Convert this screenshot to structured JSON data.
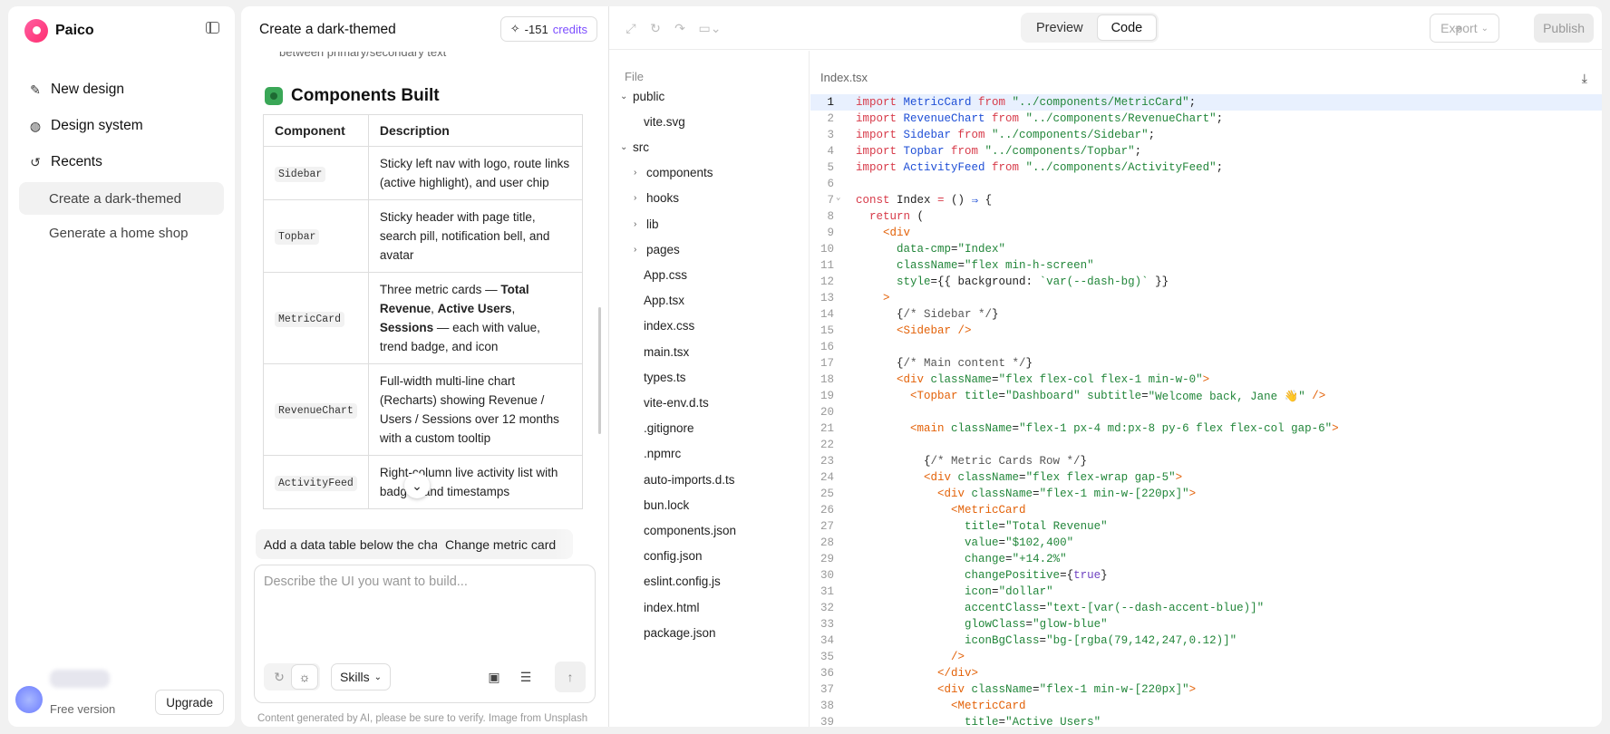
{
  "app": {
    "name": "Paico"
  },
  "sidebar": {
    "nav": [
      {
        "label": "New design",
        "icon": "edit-icon"
      },
      {
        "label": "Design system",
        "icon": "palette-icon"
      },
      {
        "label": "Recents",
        "icon": "history-icon"
      }
    ],
    "recents": [
      {
        "label": "Create a dark-themed",
        "active": true
      },
      {
        "label": "Generate a home shop",
        "active": false
      }
    ],
    "plan": "Free version",
    "upgrade": "Upgrade"
  },
  "chat": {
    "title": "Create a dark-themed",
    "credits_prefix": "-151",
    "credits_label": "credits",
    "cut_text": "between primary/secondary text",
    "section": "Components Built",
    "table": {
      "headers": [
        "Component",
        "Description"
      ],
      "rows": [
        {
          "component": "Sidebar",
          "description": "Sticky left nav with logo, route links (active highlight), and user chip"
        },
        {
          "component": "Topbar",
          "description": "Sticky header with page title, search pill, notification bell, and avatar"
        },
        {
          "component": "MetricCard",
          "description_parts": [
            "Three metric cards — ",
            "Total Revenue",
            ", ",
            "Active Users",
            ", ",
            "Sessions",
            " — each with value, trend badge, and icon"
          ]
        },
        {
          "component": "RevenueChart",
          "description": "Full-width multi-line chart (Recharts) showing Revenue / Users / Sessions over 12 months with a custom tooltip"
        },
        {
          "component": "ActivityFeed",
          "description": "Right-column live activity list with badges and timestamps"
        }
      ]
    },
    "suggestions": [
      "Add a data table below the chart",
      "Change metric card"
    ],
    "prompt_placeholder": "Describe the UI you want to build...",
    "skills": "Skills",
    "disclaimer": "Content generated by AI, please be sure to verify. Image from Unsplash"
  },
  "ide": {
    "tabs": [
      "Preview",
      "Code"
    ],
    "active_tab": "Code",
    "export": "Export",
    "publish": "Publish",
    "file_header": "File",
    "tree": [
      {
        "label": "public",
        "type": "folder-open",
        "depth": 0
      },
      {
        "label": "vite.svg",
        "type": "file",
        "depth": 1
      },
      {
        "label": "src",
        "type": "folder-open",
        "depth": 0
      },
      {
        "label": "components",
        "type": "folder",
        "depth": 1
      },
      {
        "label": "hooks",
        "type": "folder",
        "depth": 1
      },
      {
        "label": "lib",
        "type": "folder",
        "depth": 1
      },
      {
        "label": "pages",
        "type": "folder",
        "depth": 1
      },
      {
        "label": "App.css",
        "type": "file",
        "depth": 1
      },
      {
        "label": "App.tsx",
        "type": "file",
        "depth": 1
      },
      {
        "label": "index.css",
        "type": "file",
        "depth": 1
      },
      {
        "label": "main.tsx",
        "type": "file",
        "depth": 1
      },
      {
        "label": "types.ts",
        "type": "file",
        "depth": 1
      },
      {
        "label": "vite-env.d.ts",
        "type": "file",
        "depth": 1
      },
      {
        "label": ".gitignore",
        "type": "file",
        "depth": 1
      },
      {
        "label": ".npmrc",
        "type": "file",
        "depth": 1
      },
      {
        "label": "auto-imports.d.ts",
        "type": "file",
        "depth": 1
      },
      {
        "label": "bun.lock",
        "type": "file",
        "depth": 1
      },
      {
        "label": "components.json",
        "type": "file",
        "depth": 1
      },
      {
        "label": "config.json",
        "type": "file",
        "depth": 1
      },
      {
        "label": "eslint.config.js",
        "type": "file",
        "depth": 1
      },
      {
        "label": "index.html",
        "type": "file",
        "depth": 1
      },
      {
        "label": "package.json",
        "type": "file",
        "depth": 1
      }
    ],
    "file_name": "Index.tsx",
    "current_line": 1,
    "code": [
      [
        [
          "kw",
          "import "
        ],
        [
          "cmp",
          "MetricCard"
        ],
        [
          "kw",
          " from "
        ],
        [
          "str",
          "\"../components/MetricCard\""
        ],
        [
          "plain",
          ";"
        ]
      ],
      [
        [
          "kw",
          "import "
        ],
        [
          "cmp",
          "RevenueChart"
        ],
        [
          "kw",
          " from "
        ],
        [
          "str",
          "\"../components/RevenueChart\""
        ],
        [
          "plain",
          ";"
        ]
      ],
      [
        [
          "kw",
          "import "
        ],
        [
          "cmp",
          "Sidebar"
        ],
        [
          "kw",
          " from "
        ],
        [
          "str",
          "\"../components/Sidebar\""
        ],
        [
          "plain",
          ";"
        ]
      ],
      [
        [
          "kw",
          "import "
        ],
        [
          "cmp",
          "Topbar"
        ],
        [
          "kw",
          " from "
        ],
        [
          "str",
          "\"../components/Topbar\""
        ],
        [
          "plain",
          ";"
        ]
      ],
      [
        [
          "kw",
          "import "
        ],
        [
          "cmp",
          "ActivityFeed"
        ],
        [
          "kw",
          " from "
        ],
        [
          "str",
          "\"../components/ActivityFeed\""
        ],
        [
          "plain",
          ";"
        ]
      ],
      [],
      [
        [
          "kw",
          "const "
        ],
        [
          "plain",
          "Index "
        ],
        [
          "kw",
          "= "
        ],
        [
          "plain",
          "() "
        ],
        [
          "cmp",
          "⇒"
        ],
        [
          "plain",
          " {"
        ]
      ],
      [
        [
          "plain",
          "  "
        ],
        [
          "kw",
          "return"
        ],
        [
          "plain",
          " ("
        ]
      ],
      [
        [
          "plain",
          "    "
        ],
        [
          "tag",
          "<div"
        ]
      ],
      [
        [
          "plain",
          "      "
        ],
        [
          "str",
          "data-cmp"
        ],
        [
          "plain",
          "="
        ],
        [
          "str",
          "\"Index\""
        ]
      ],
      [
        [
          "plain",
          "      "
        ],
        [
          "str",
          "className"
        ],
        [
          "plain",
          "="
        ],
        [
          "str",
          "\"flex min-h-screen\""
        ]
      ],
      [
        [
          "plain",
          "      "
        ],
        [
          "str",
          "style"
        ],
        [
          "plain",
          "={{ background: "
        ],
        [
          "str",
          "`var(--dash-bg)`"
        ],
        [
          "plain",
          " }}"
        ]
      ],
      [
        [
          "plain",
          "    "
        ],
        [
          "tag",
          ">"
        ]
      ],
      [
        [
          "plain",
          "      {"
        ],
        [
          "cm",
          "/* Sidebar */"
        ],
        [
          "plain",
          "}"
        ]
      ],
      [
        [
          "plain",
          "      "
        ],
        [
          "tag",
          "<Sidebar />"
        ]
      ],
      [],
      [
        [
          "plain",
          "      {"
        ],
        [
          "cm",
          "/* Main content */"
        ],
        [
          "plain",
          "}"
        ]
      ],
      [
        [
          "plain",
          "      "
        ],
        [
          "tag",
          "<div "
        ],
        [
          "str",
          "className"
        ],
        [
          "plain",
          "="
        ],
        [
          "str",
          "\"flex flex-col flex-1 min-w-0\""
        ],
        [
          "tag",
          ">"
        ]
      ],
      [
        [
          "plain",
          "        "
        ],
        [
          "tag",
          "<Topbar "
        ],
        [
          "str",
          "title"
        ],
        [
          "plain",
          "="
        ],
        [
          "str",
          "\"Dashboard\" "
        ],
        [
          "str",
          "subtitle"
        ],
        [
          "plain",
          "="
        ],
        [
          "str",
          "\"Welcome back, Jane 👋\""
        ],
        [
          "tag",
          " />"
        ]
      ],
      [],
      [
        [
          "plain",
          "        "
        ],
        [
          "tag",
          "<main "
        ],
        [
          "str",
          "className"
        ],
        [
          "plain",
          "="
        ],
        [
          "str",
          "\"flex-1 px-4 md:px-8 py-6 flex flex-col gap-6\""
        ],
        [
          "tag",
          ">"
        ]
      ],
      [],
      [
        [
          "plain",
          "          {"
        ],
        [
          "cm",
          "/* Metric Cards Row */"
        ],
        [
          "plain",
          "}"
        ]
      ],
      [
        [
          "plain",
          "          "
        ],
        [
          "tag",
          "<div "
        ],
        [
          "str",
          "className"
        ],
        [
          "plain",
          "="
        ],
        [
          "str",
          "\"flex flex-wrap gap-5\""
        ],
        [
          "tag",
          ">"
        ]
      ],
      [
        [
          "plain",
          "            "
        ],
        [
          "tag",
          "<div "
        ],
        [
          "str",
          "className"
        ],
        [
          "plain",
          "="
        ],
        [
          "str",
          "\"flex-1 min-w-[220px]\""
        ],
        [
          "tag",
          ">"
        ]
      ],
      [
        [
          "plain",
          "              "
        ],
        [
          "tag",
          "<MetricCard"
        ]
      ],
      [
        [
          "plain",
          "                "
        ],
        [
          "str",
          "title"
        ],
        [
          "plain",
          "="
        ],
        [
          "str",
          "\"Total Revenue\""
        ]
      ],
      [
        [
          "plain",
          "                "
        ],
        [
          "str",
          "value"
        ],
        [
          "plain",
          "="
        ],
        [
          "str",
          "\"$102,400\""
        ]
      ],
      [
        [
          "plain",
          "                "
        ],
        [
          "str",
          "change"
        ],
        [
          "plain",
          "="
        ],
        [
          "str",
          "\"+14.2%\""
        ]
      ],
      [
        [
          "plain",
          "                "
        ],
        [
          "str",
          "changePositive"
        ],
        [
          "plain",
          "={"
        ],
        [
          "attr",
          "true"
        ],
        [
          "plain",
          "}"
        ]
      ],
      [
        [
          "plain",
          "                "
        ],
        [
          "str",
          "icon"
        ],
        [
          "plain",
          "="
        ],
        [
          "str",
          "\"dollar\""
        ]
      ],
      [
        [
          "plain",
          "                "
        ],
        [
          "str",
          "accentClass"
        ],
        [
          "plain",
          "="
        ],
        [
          "str",
          "\"text-[var(--dash-accent-blue)]\""
        ]
      ],
      [
        [
          "plain",
          "                "
        ],
        [
          "str",
          "glowClass"
        ],
        [
          "plain",
          "="
        ],
        [
          "str",
          "\"glow-blue\""
        ]
      ],
      [
        [
          "plain",
          "                "
        ],
        [
          "str",
          "iconBgClass"
        ],
        [
          "plain",
          "="
        ],
        [
          "str",
          "\"bg-[rgba(79,142,247,0.12)]\""
        ]
      ],
      [
        [
          "plain",
          "              "
        ],
        [
          "tag",
          "/>"
        ]
      ],
      [
        [
          "plain",
          "            "
        ],
        [
          "tag",
          "</div>"
        ]
      ],
      [
        [
          "plain",
          "            "
        ],
        [
          "tag",
          "<div "
        ],
        [
          "str",
          "className"
        ],
        [
          "plain",
          "="
        ],
        [
          "str",
          "\"flex-1 min-w-[220px]\""
        ],
        [
          "tag",
          ">"
        ]
      ],
      [
        [
          "plain",
          "              "
        ],
        [
          "tag",
          "<MetricCard"
        ]
      ],
      [
        [
          "plain",
          "                "
        ],
        [
          "str",
          "title"
        ],
        [
          "plain",
          "="
        ],
        [
          "str",
          "\"Active Users\""
        ]
      ]
    ]
  }
}
